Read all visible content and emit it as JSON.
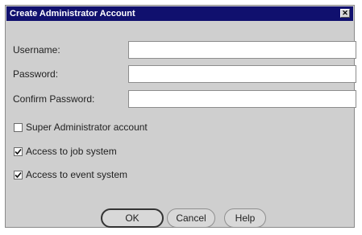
{
  "dialog": {
    "title": "Create Administrator Account",
    "close_glyph": "✕"
  },
  "fields": {
    "username_label": "Username:",
    "username_value": "",
    "password_label": "Password:",
    "password_value": "",
    "confirm_label": "Confirm Password:",
    "confirm_value": ""
  },
  "options": [
    {
      "label": "Super Administrator account",
      "checked": false
    },
    {
      "label": "Access to job system",
      "checked": true
    },
    {
      "label": "Access to event system",
      "checked": true
    }
  ],
  "buttons": {
    "ok": "OK",
    "cancel": "Cancel",
    "help": "Help"
  },
  "icons": {
    "close": "close-icon",
    "check": "checkmark-icon"
  }
}
